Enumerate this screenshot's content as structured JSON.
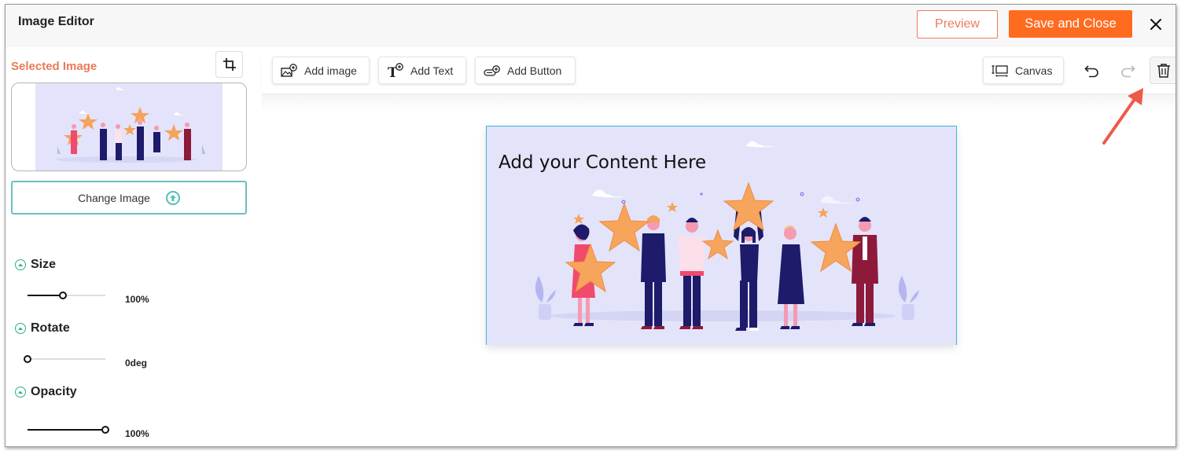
{
  "window": {
    "title": "Image Editor",
    "preview_label": "Preview",
    "save_label": "Save and Close",
    "close_icon": "close-icon"
  },
  "colors": {
    "accent": "#ff6b1f",
    "preview_border": "#f07a5b",
    "selected_label": "#ea7a58",
    "teal": "#6cc0bf",
    "section_icon": "#2bb37a",
    "canvas_border": "#39b6e6",
    "canvas_bg": "#e3e3fa",
    "annotation_arrow": "#ee5a48"
  },
  "sidebar": {
    "selected_image_label": "Selected Image",
    "crop_icon": "crop-icon",
    "change_image_label": "Change Image",
    "upload_icon": "upload-arrow-icon",
    "sections": [
      {
        "name": "Size",
        "value_text": "100%",
        "slider_fraction": 0.45
      },
      {
        "name": "Rotate",
        "value_text": "0deg",
        "slider_fraction": 0.0
      },
      {
        "name": "Opacity",
        "value_text": "100%",
        "slider_fraction": 1.0
      }
    ]
  },
  "toolbar": {
    "add_image_label": "Add image",
    "add_text_label": "Add Text",
    "add_button_label": "Add Button",
    "canvas_label": "Canvas",
    "undo_icon": "undo-icon",
    "redo_icon": "redo-icon",
    "delete_icon": "trash-icon"
  },
  "canvas": {
    "heading_text": "Add your Content Here",
    "image_description": "illustration of six people holding star ratings"
  }
}
